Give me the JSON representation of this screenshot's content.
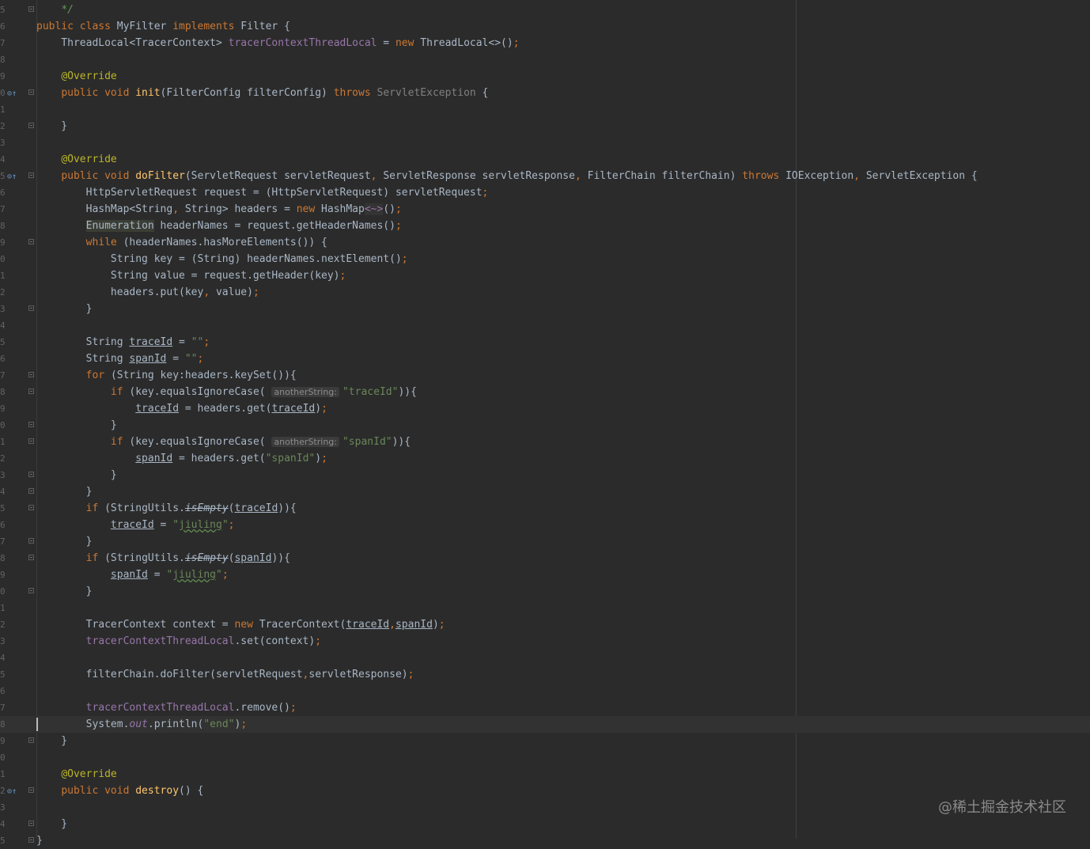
{
  "editor": {
    "language": "java",
    "colors": {
      "background": "#2b2b2b",
      "keyword": "#cc7832",
      "annotation": "#bbb529",
      "method_declaration": "#ffc66d",
      "field": "#9876aa",
      "string": "#6a8759",
      "comment": "#629755",
      "default": "#a9b7c6"
    },
    "current_line_index": 43,
    "lines": [
      {
        "n": "5",
        "icon": "",
        "fold": true,
        "tokens": [
          {
            "t": "    "
          },
          {
            "t": "*/",
            "c": "cm"
          }
        ]
      },
      {
        "n": "6",
        "icon": "",
        "fold": false,
        "tokens": [
          {
            "t": "public class ",
            "c": "kw"
          },
          {
            "t": "MyFilter "
          },
          {
            "t": "implements ",
            "c": "kw"
          },
          {
            "t": "Filter {"
          }
        ]
      },
      {
        "n": "7",
        "icon": "",
        "fold": false,
        "tokens": [
          {
            "t": "    ThreadLocal<TracerContext> "
          },
          {
            "t": "tracerContextThreadLocal",
            "c": "fld"
          },
          {
            "t": " = "
          },
          {
            "t": "new ",
            "c": "kw"
          },
          {
            "t": "ThreadLocal<>()"
          },
          {
            "t": ";",
            "c": "kw"
          }
        ]
      },
      {
        "n": "8",
        "icon": "",
        "fold": false,
        "tokens": []
      },
      {
        "n": "9",
        "icon": "",
        "fold": false,
        "tokens": [
          {
            "t": "    "
          },
          {
            "t": "@Override",
            "c": "an"
          }
        ]
      },
      {
        "n": "0",
        "icon": "override",
        "fold": true,
        "tokens": [
          {
            "t": "    "
          },
          {
            "t": "public void ",
            "c": "kw"
          },
          {
            "t": "init",
            "c": "fn"
          },
          {
            "t": "(FilterConfig filterConfig) "
          },
          {
            "t": "throws ",
            "c": "kw"
          },
          {
            "t": "ServletException",
            "c": "gr"
          },
          {
            "t": " {"
          }
        ]
      },
      {
        "n": "1",
        "icon": "",
        "fold": false,
        "tokens": []
      },
      {
        "n": "2",
        "icon": "",
        "fold": true,
        "tokens": [
          {
            "t": "    }"
          }
        ]
      },
      {
        "n": "3",
        "icon": "",
        "fold": false,
        "tokens": []
      },
      {
        "n": "4",
        "icon": "",
        "fold": false,
        "tokens": [
          {
            "t": "    "
          },
          {
            "t": "@Override",
            "c": "an"
          }
        ]
      },
      {
        "n": "5",
        "icon": "override",
        "fold": true,
        "tokens": [
          {
            "t": "    "
          },
          {
            "t": "public void ",
            "c": "kw"
          },
          {
            "t": "doFilter",
            "c": "fn"
          },
          {
            "t": "(ServletRequest servletRequest"
          },
          {
            "t": ", ",
            "c": "kw"
          },
          {
            "t": "ServletResponse servletResponse"
          },
          {
            "t": ", ",
            "c": "kw"
          },
          {
            "t": "FilterChain filterChain) "
          },
          {
            "t": "throws ",
            "c": "kw"
          },
          {
            "t": "IOException"
          },
          {
            "t": ", ",
            "c": "kw"
          },
          {
            "t": "ServletException {"
          }
        ]
      },
      {
        "n": "6",
        "icon": "",
        "fold": false,
        "tokens": [
          {
            "t": "        HttpServletRequest request = (HttpServletRequest) servletRequest"
          },
          {
            "t": ";",
            "c": "kw"
          }
        ]
      },
      {
        "n": "7",
        "icon": "",
        "fold": false,
        "tokens": [
          {
            "t": "        HashMap<String"
          },
          {
            "t": ", ",
            "c": "kw"
          },
          {
            "t": "String> headers = "
          },
          {
            "t": "new ",
            "c": "kw"
          },
          {
            "t": "HashMap"
          },
          {
            "t": "<~>",
            "c": "diamond"
          },
          {
            "t": "()"
          },
          {
            "t": ";",
            "c": "kw"
          }
        ]
      },
      {
        "n": "8",
        "icon": "",
        "fold": false,
        "tokens": [
          {
            "t": "        "
          },
          {
            "t": "Enumeration",
            "c": "hl"
          },
          {
            "t": " headerNames = request.getHeaderNames()"
          },
          {
            "t": ";",
            "c": "kw"
          }
        ]
      },
      {
        "n": "9",
        "icon": "",
        "fold": true,
        "tokens": [
          {
            "t": "        "
          },
          {
            "t": "while ",
            "c": "kw"
          },
          {
            "t": "(headerNames.hasMoreElements()) {"
          }
        ]
      },
      {
        "n": "0",
        "icon": "",
        "fold": false,
        "tokens": [
          {
            "t": "            String key = (String) headerNames.nextElement()"
          },
          {
            "t": ";",
            "c": "kw"
          }
        ]
      },
      {
        "n": "1",
        "icon": "",
        "fold": false,
        "tokens": [
          {
            "t": "            String value = request.getHeader(key)"
          },
          {
            "t": ";",
            "c": "kw"
          }
        ]
      },
      {
        "n": "2",
        "icon": "",
        "fold": false,
        "tokens": [
          {
            "t": "            headers.put(key"
          },
          {
            "t": ", ",
            "c": "kw"
          },
          {
            "t": "value)"
          },
          {
            "t": ";",
            "c": "kw"
          }
        ]
      },
      {
        "n": "3",
        "icon": "",
        "fold": true,
        "tokens": [
          {
            "t": "        }"
          }
        ]
      },
      {
        "n": "4",
        "icon": "",
        "fold": false,
        "tokens": []
      },
      {
        "n": "5",
        "icon": "",
        "fold": false,
        "tokens": [
          {
            "t": "        String "
          },
          {
            "t": "traceId",
            "c": "ul"
          },
          {
            "t": " = "
          },
          {
            "t": "\"\"",
            "c": "st"
          },
          {
            "t": ";",
            "c": "kw"
          }
        ]
      },
      {
        "n": "6",
        "icon": "",
        "fold": false,
        "tokens": [
          {
            "t": "        String "
          },
          {
            "t": "spanId",
            "c": "ul"
          },
          {
            "t": " = "
          },
          {
            "t": "\"\"",
            "c": "st"
          },
          {
            "t": ";",
            "c": "kw"
          }
        ]
      },
      {
        "n": "7",
        "icon": "",
        "fold": true,
        "tokens": [
          {
            "t": "        "
          },
          {
            "t": "for ",
            "c": "kw"
          },
          {
            "t": "(String key:headers.keySet()){"
          }
        ]
      },
      {
        "n": "8",
        "icon": "",
        "fold": true,
        "tokens": [
          {
            "t": "            "
          },
          {
            "t": "if ",
            "c": "kw"
          },
          {
            "t": "(key.equalsIgnoreCase( "
          },
          {
            "t": "anotherString:",
            "c": "hint"
          },
          {
            "t": "\"traceId\"",
            "c": "st"
          },
          {
            "t": ")){"
          }
        ]
      },
      {
        "n": "9",
        "icon": "",
        "fold": false,
        "tokens": [
          {
            "t": "                "
          },
          {
            "t": "traceId",
            "c": "ul"
          },
          {
            "t": " = headers.get("
          },
          {
            "t": "traceId",
            "c": "ul"
          },
          {
            "t": ")"
          },
          {
            "t": ";",
            "c": "kw"
          }
        ]
      },
      {
        "n": "0",
        "icon": "",
        "fold": true,
        "tokens": [
          {
            "t": "            }"
          }
        ]
      },
      {
        "n": "1",
        "icon": "",
        "fold": true,
        "tokens": [
          {
            "t": "            "
          },
          {
            "t": "if ",
            "c": "kw"
          },
          {
            "t": "(key.equalsIgnoreCase( "
          },
          {
            "t": "anotherString:",
            "c": "hint"
          },
          {
            "t": "\"spanId\"",
            "c": "st"
          },
          {
            "t": ")){"
          }
        ]
      },
      {
        "n": "2",
        "icon": "",
        "fold": false,
        "tokens": [
          {
            "t": "                "
          },
          {
            "t": "spanId",
            "c": "ul"
          },
          {
            "t": " = headers.get("
          },
          {
            "t": "\"spanId\"",
            "c": "st"
          },
          {
            "t": ")"
          },
          {
            "t": ";",
            "c": "kw"
          }
        ]
      },
      {
        "n": "3",
        "icon": "",
        "fold": true,
        "tokens": [
          {
            "t": "            }"
          }
        ]
      },
      {
        "n": "4",
        "icon": "",
        "fold": true,
        "tokens": [
          {
            "t": "        }"
          }
        ]
      },
      {
        "n": "5",
        "icon": "",
        "fold": true,
        "tokens": [
          {
            "t": "        "
          },
          {
            "t": "if ",
            "c": "kw"
          },
          {
            "t": "(StringUtils."
          },
          {
            "t": "isEmpty",
            "c": "strike"
          },
          {
            "t": "("
          },
          {
            "t": "traceId",
            "c": "ul"
          },
          {
            "t": ")){"
          }
        ]
      },
      {
        "n": "6",
        "icon": "",
        "fold": false,
        "tokens": [
          {
            "t": "            "
          },
          {
            "t": "traceId",
            "c": "ul"
          },
          {
            "t": " = "
          },
          {
            "t": "\"",
            "c": "st"
          },
          {
            "t": "jiuling",
            "c": "st typo"
          },
          {
            "t": "\"",
            "c": "st"
          },
          {
            "t": ";",
            "c": "kw"
          }
        ]
      },
      {
        "n": "7",
        "icon": "",
        "fold": true,
        "tokens": [
          {
            "t": "        }"
          }
        ]
      },
      {
        "n": "8",
        "icon": "",
        "fold": true,
        "tokens": [
          {
            "t": "        "
          },
          {
            "t": "if ",
            "c": "kw"
          },
          {
            "t": "(StringUtils."
          },
          {
            "t": "isEmpty",
            "c": "strike"
          },
          {
            "t": "("
          },
          {
            "t": "spanId",
            "c": "ul"
          },
          {
            "t": ")){"
          }
        ]
      },
      {
        "n": "9",
        "icon": "",
        "fold": false,
        "tokens": [
          {
            "t": "            "
          },
          {
            "t": "spanId",
            "c": "ul"
          },
          {
            "t": " = "
          },
          {
            "t": "\"",
            "c": "st"
          },
          {
            "t": "jiuling",
            "c": "st typo"
          },
          {
            "t": "\"",
            "c": "st"
          },
          {
            "t": ";",
            "c": "kw"
          }
        ]
      },
      {
        "n": "0",
        "icon": "",
        "fold": true,
        "tokens": [
          {
            "t": "        }"
          }
        ]
      },
      {
        "n": "1",
        "icon": "",
        "fold": false,
        "tokens": []
      },
      {
        "n": "2",
        "icon": "",
        "fold": false,
        "tokens": [
          {
            "t": "        TracerContext context = "
          },
          {
            "t": "new ",
            "c": "kw"
          },
          {
            "t": "TracerContext("
          },
          {
            "t": "traceId",
            "c": "ul"
          },
          {
            "t": ",",
            "c": "kw"
          },
          {
            "t": "spanId",
            "c": "ul"
          },
          {
            "t": ")"
          },
          {
            "t": ";",
            "c": "kw"
          }
        ]
      },
      {
        "n": "3",
        "icon": "",
        "fold": false,
        "tokens": [
          {
            "t": "        "
          },
          {
            "t": "tracerContextThreadLocal",
            "c": "fld"
          },
          {
            "t": ".set(context)"
          },
          {
            "t": ";",
            "c": "kw"
          }
        ]
      },
      {
        "n": "4",
        "icon": "",
        "fold": false,
        "tokens": []
      },
      {
        "n": "5",
        "icon": "",
        "fold": false,
        "tokens": [
          {
            "t": "        filterChain.doFilter(servletRequest"
          },
          {
            "t": ",",
            "c": "kw"
          },
          {
            "t": "servletResponse)"
          },
          {
            "t": ";",
            "c": "kw"
          }
        ]
      },
      {
        "n": "6",
        "icon": "",
        "fold": false,
        "tokens": []
      },
      {
        "n": "7",
        "icon": "",
        "fold": false,
        "tokens": [
          {
            "t": "        "
          },
          {
            "t": "tracerContextThreadLocal",
            "c": "fld"
          },
          {
            "t": ".remove()"
          },
          {
            "t": ";",
            "c": "kw"
          }
        ]
      },
      {
        "n": "8",
        "icon": "",
        "fold": false,
        "tokens": [
          {
            "t": "        System."
          },
          {
            "t": "out",
            "c": "fld ital"
          },
          {
            "t": ".println("
          },
          {
            "t": "\"end\"",
            "c": "st"
          },
          {
            "t": ")"
          },
          {
            "t": ";",
            "c": "kw"
          }
        ]
      },
      {
        "n": "9",
        "icon": "",
        "fold": true,
        "tokens": [
          {
            "t": "    }"
          }
        ]
      },
      {
        "n": "0",
        "icon": "",
        "fold": false,
        "tokens": []
      },
      {
        "n": "1",
        "icon": "",
        "fold": false,
        "tokens": [
          {
            "t": "    "
          },
          {
            "t": "@Override",
            "c": "an"
          }
        ]
      },
      {
        "n": "2",
        "icon": "override",
        "fold": true,
        "tokens": [
          {
            "t": "    "
          },
          {
            "t": "public void ",
            "c": "kw"
          },
          {
            "t": "destroy",
            "c": "fn"
          },
          {
            "t": "() {"
          }
        ]
      },
      {
        "n": "3",
        "icon": "",
        "fold": false,
        "tokens": []
      },
      {
        "n": "4",
        "icon": "",
        "fold": true,
        "tokens": [
          {
            "t": "    }"
          }
        ]
      },
      {
        "n": "5",
        "icon": "",
        "fold": true,
        "tokens": [
          {
            "t": "}"
          }
        ]
      }
    ],
    "gutter_icons": {
      "override": "⊙↑"
    }
  },
  "watermark": {
    "text": "@稀土掘金技术社区"
  }
}
